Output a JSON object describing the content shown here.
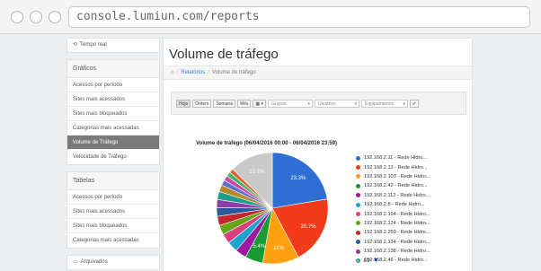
{
  "browser": {
    "url": "console.lumiun.com/reports"
  },
  "sidebar": {
    "realtime": {
      "icon": "sync-icon",
      "label": "Tempo real"
    },
    "graficos": {
      "header": "Gráficos",
      "items": [
        {
          "label": "Acessos por período",
          "active": false
        },
        {
          "label": "Sites mais acessados",
          "active": false
        },
        {
          "label": "Sites mais bloqueados",
          "active": false
        },
        {
          "label": "Categorias mais acessadas",
          "active": false
        },
        {
          "label": "Volume de Tráfego",
          "active": true
        },
        {
          "label": "Velocidade de Tráfego",
          "active": false
        }
      ]
    },
    "tabelas": {
      "header": "Tabelas",
      "items": [
        {
          "label": "Acessos por período"
        },
        {
          "label": "Sites mais acessados"
        },
        {
          "label": "Sites mais bloqueados"
        },
        {
          "label": "Categorias mais acessadas"
        }
      ]
    },
    "arquivados": {
      "icon": "folder-icon",
      "label": "Arquivados"
    }
  },
  "main": {
    "title": "Volume de tráfego",
    "breadcrumb": {
      "home_icon": "home-icon",
      "link": "Relatórios",
      "current": "Volume de tráfego"
    },
    "toolbar": {
      "buttons": [
        "Hoje",
        "Ontem",
        "Semana",
        "Mês"
      ],
      "active": "Hoje",
      "calendar_icon": "calendar-icon",
      "selects": [
        "Grupos",
        "Usuários",
        "Equipamentos"
      ],
      "confirm_icon": "check-icon"
    }
  },
  "chart_data": {
    "type": "pie",
    "title": "Volume de tráfego (06/04/2016 00:00 - 06/04/2016 23:59)",
    "slices": [
      {
        "label": "192.168.2.11 - Rede Hidro...",
        "value": 23.3,
        "color": "#2f6fd3",
        "show_label": true
      },
      {
        "label": "192.168.2.13 - Rede Hidro...",
        "value": 20.7,
        "color": "#f23b1a",
        "show_label": true
      },
      {
        "label": "192.168.2.103 - Rede Hidro...",
        "value": 11,
        "color": "#ffa010",
        "show_label": true
      },
      {
        "label": "192.168.2.42 - Rede Hidro...",
        "value": 5.4,
        "color": "#169a31",
        "show_label": true
      },
      {
        "label": "192.168.2.112 - Rede Hidro...",
        "value": 3.4,
        "color": "#9c1aa0",
        "show_label": false
      },
      {
        "label": "192.168.2.8 - Rede Hidro...",
        "value": 3.2,
        "color": "#1aa6cc",
        "show_label": false
      },
      {
        "label": "192.168.2.104 - Rede Hidro...",
        "value": 3,
        "color": "#d9417e",
        "show_label": false
      },
      {
        "label": "192.168.2.124 - Rede Hidro...",
        "value": 2.9,
        "color": "#67a515",
        "show_label": false
      },
      {
        "label": "192.168.2.250 - Rede Hidro...",
        "value": 2.8,
        "color": "#c4252b",
        "show_label": false
      },
      {
        "label": "192.168.2.134 - Rede Hidro...",
        "value": 2.6,
        "color": "#2a5a9a",
        "show_label": false
      },
      {
        "label": "192.168.2.138 - Rede Hidro...",
        "value": 2.5,
        "color": "#8f3ea8",
        "show_label": false
      },
      {
        "label": "192.168.2.46 - Rede Hidro...",
        "value": 2.4,
        "color": "#1e9e8a",
        "show_label": false
      },
      {
        "label": "",
        "value": 2.1,
        "color": "#b38a2a",
        "show_label": false
      },
      {
        "label": "",
        "value": 1.6,
        "color": "#5b6fd0",
        "show_label": false
      },
      {
        "label": "",
        "value": 1.5,
        "color": "#cc4aa3",
        "show_label": false
      },
      {
        "label": "",
        "value": 1.4,
        "color": "#3cba6a",
        "show_label": false
      },
      {
        "label": "",
        "value": 1.3,
        "color": "#e0642c",
        "show_label": false
      },
      {
        "label": "",
        "value": 13.1,
        "color": "#c9c9c9",
        "show_label": true
      }
    ],
    "legend_page": "1/2",
    "legend_placement": "right"
  }
}
